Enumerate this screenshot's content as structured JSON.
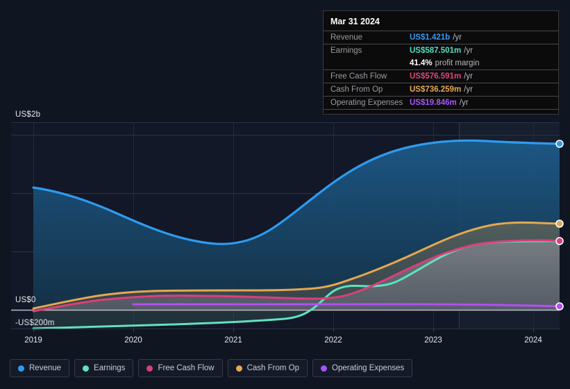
{
  "tooltip": {
    "title": "Mar 31 2024",
    "rows": [
      {
        "key": "Revenue",
        "value": "US$1.421b",
        "unit": "/yr",
        "color": "#2e9bf0"
      },
      {
        "key": "Earnings",
        "value": "US$587.501m",
        "unit": "/yr",
        "color": "#4fe0bd"
      },
      {
        "key": "Free Cash Flow",
        "value": "US$576.591m",
        "unit": "/yr",
        "color": "#e0447e"
      },
      {
        "key": "Cash From Op",
        "value": "US$736.259m",
        "unit": "/yr",
        "color": "#e6a84f"
      },
      {
        "key": "Operating Expenses",
        "value": "US$19.846m",
        "unit": "/yr",
        "color": "#a855f7"
      }
    ],
    "margin_value": "41.4%",
    "margin_label": "profit margin"
  },
  "legend": {
    "items": [
      {
        "label": "Revenue",
        "color": "#2e9bf0"
      },
      {
        "label": "Earnings",
        "color": "#5fe3c0"
      },
      {
        "label": "Free Cash Flow",
        "color": "#d9407a"
      },
      {
        "label": "Cash From Op",
        "color": "#e6a84f"
      },
      {
        "label": "Operating Expenses",
        "color": "#a855f7"
      }
    ]
  },
  "axes": {
    "y_top_label": "US$2b",
    "y_zero_label": "US$0",
    "y_bottom_label": "-US$200m",
    "x_labels": [
      "2019",
      "2020",
      "2021",
      "2022",
      "2023",
      "2024"
    ]
  },
  "chart_data": {
    "type": "area",
    "title": "",
    "xlabel": "",
    "ylabel": "",
    "ylim": [
      -200,
      2000
    ],
    "y_unit": "US$ millions",
    "y_ticks": [
      2000,
      1500,
      1000,
      500,
      0,
      -200
    ],
    "grid": true,
    "legend_position": "bottom",
    "forecast_boundary_x": "2023.5",
    "x": [
      "2019.0",
      "2019.25",
      "2019.5",
      "2019.75",
      "2020.0",
      "2020.25",
      "2020.5",
      "2020.75",
      "2021.0",
      "2021.25",
      "2021.5",
      "2021.75",
      "2022.0",
      "2022.25",
      "2022.5",
      "2022.75",
      "2023.0",
      "2023.25",
      "2023.5",
      "2023.75",
      "2024.0",
      "2024.25"
    ],
    "series": [
      {
        "name": "Revenue",
        "color": "#2e9bf0",
        "values": [
          1045,
          1010,
          975,
          930,
          880,
          830,
          790,
          755,
          730,
          725,
          745,
          790,
          850,
          930,
          1010,
          1085,
          1160,
          1250,
          1330,
          1390,
          1421,
          1421
        ]
      },
      {
        "name": "Earnings",
        "color": "#5fe3c0",
        "values": [
          -165,
          -163,
          -160,
          -158,
          -155,
          -152,
          -150,
          -148,
          -145,
          -140,
          -132,
          -120,
          -100,
          55,
          120,
          110,
          170,
          300,
          420,
          520,
          570,
          587.5
        ]
      },
      {
        "name": "Free Cash Flow",
        "color": "#d9407a",
        "values": [
          -15,
          20,
          55,
          85,
          110,
          128,
          140,
          146,
          148,
          148,
          147,
          145,
          140,
          135,
          130,
          170,
          250,
          350,
          450,
          530,
          570,
          576.6
        ]
      },
      {
        "name": "Cash From Op",
        "color": "#e6a84f",
        "values": [
          5,
          45,
          82,
          115,
          142,
          162,
          176,
          184,
          188,
          190,
          190,
          189,
          188,
          195,
          230,
          290,
          370,
          460,
          560,
          660,
          725,
          736.3
        ]
      },
      {
        "name": "Operating Expenses",
        "color": "#a855f7",
        "values": [
          null,
          null,
          null,
          null,
          18,
          18,
          18,
          18,
          18,
          18,
          18,
          18,
          19,
          19,
          19,
          19,
          19,
          19.5,
          19.5,
          19.8,
          19.8,
          19.8
        ]
      }
    ]
  }
}
